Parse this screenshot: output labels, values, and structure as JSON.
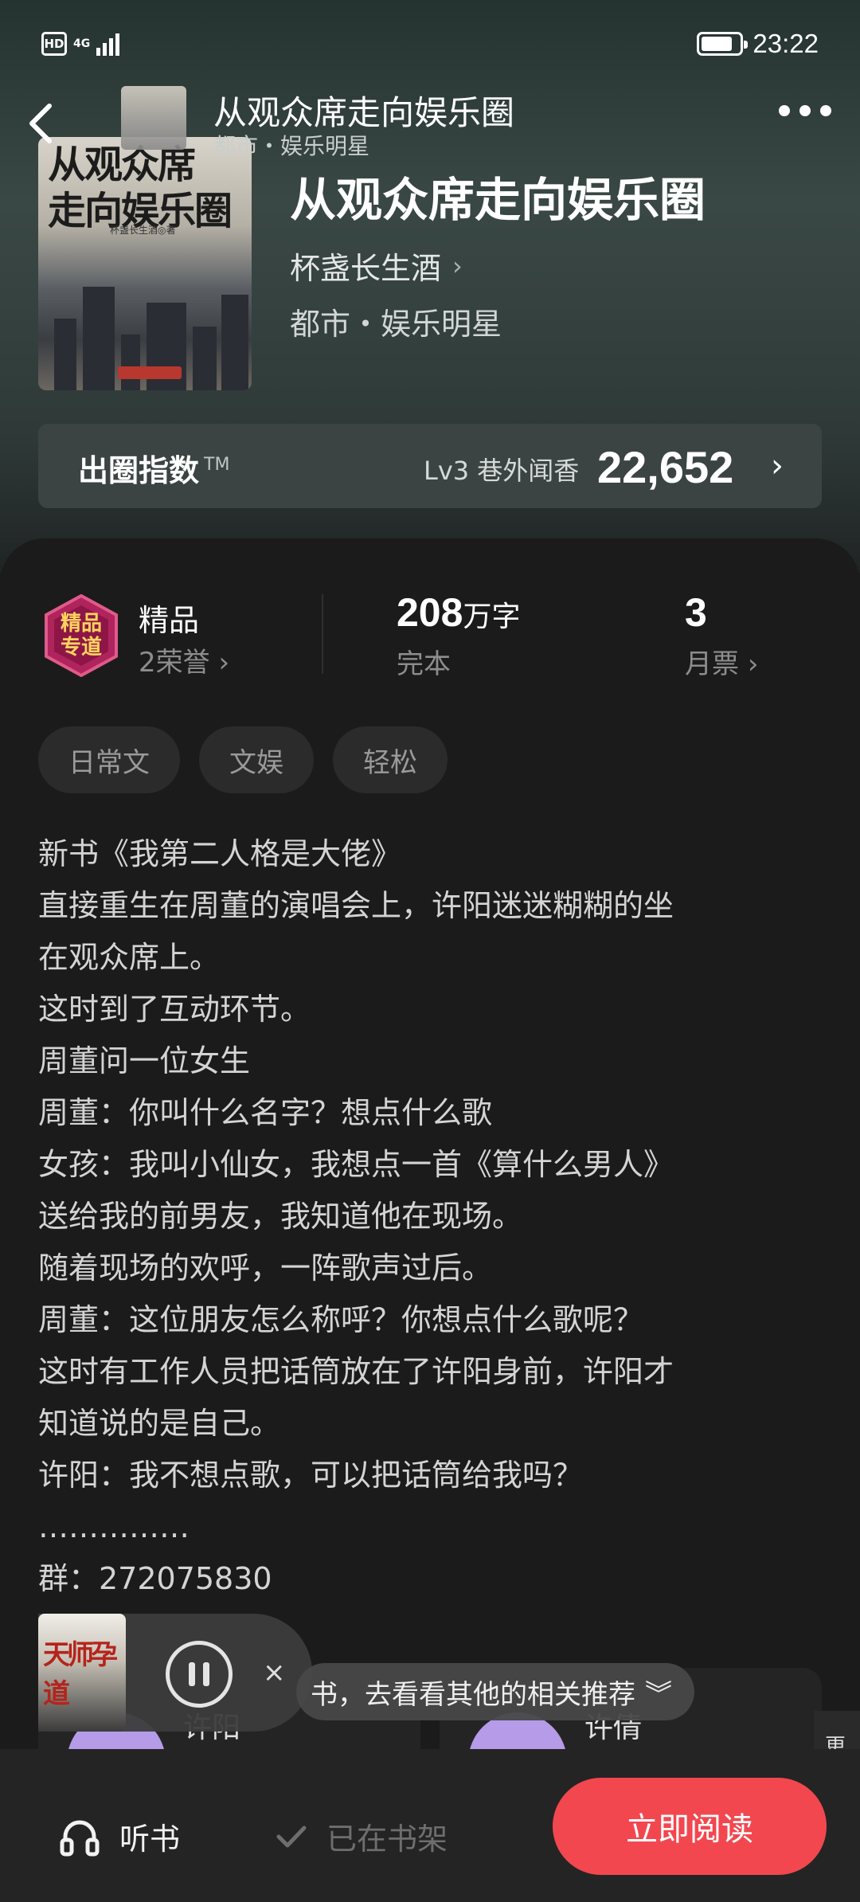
{
  "status_bar": {
    "hd": "HD",
    "network": "4G",
    "time": "23:22"
  },
  "nav": {
    "title": "从观众席走向娱乐圈",
    "subtitle": "都市・娱乐明星"
  },
  "book": {
    "cover_title_line1": "从观众席",
    "cover_title_line2": "走向娱乐圈",
    "cover_author": "杯盏长生酒◎著",
    "title": "从观众席走向娱乐圈",
    "author": "杯盏长生酒",
    "genre": "都市・娱乐明星"
  },
  "index_card": {
    "label": "出圈指数",
    "tm": "TM",
    "level": "Lv3 巷外闻香",
    "value": "22,652"
  },
  "stats": {
    "badge_text": "精品\n专道",
    "quality": "精品",
    "honors": "2荣誉",
    "words_num": "208",
    "words_unit": "万字",
    "status": "完本",
    "votes": "3",
    "votes_label": "月票"
  },
  "tags": [
    "日常文",
    "文娱",
    "轻松"
  ],
  "description": [
    "新书《我第二人格是大佬》",
    "直接重生在周董的演唱会上，许阳迷迷糊糊的坐",
    "在观众席上。",
    "这时到了互动环节。",
    "周董问一位女生",
    "周董：你叫什么名字？想点什么歌",
    "女孩：我叫小仙女，我想点一首《算什么男人》",
    "送给我的前男友，我知道他在现场。",
    "随着现场的欢呼，一阵歌声过后。",
    "周董：这位朋友怎么称呼？你想点什么歌呢？",
    "这时有工作人员把话筒放在了许阳身前，许阳才",
    "知道说的是自己。",
    "许阳：我不想点歌，可以把话筒给我吗？",
    "……………",
    "群：272075830"
  ],
  "mini_player": {
    "cover_text": "天师孕道"
  },
  "toast": {
    "text": "书，去看看其他的相关推荐"
  },
  "recommendations": [
    {
      "name": "许阳"
    },
    {
      "name": "许倩"
    }
  ],
  "rec_edge": "更",
  "bottom_bar": {
    "listen": "听书",
    "shelf": "已在书架",
    "read": "立即阅读"
  }
}
